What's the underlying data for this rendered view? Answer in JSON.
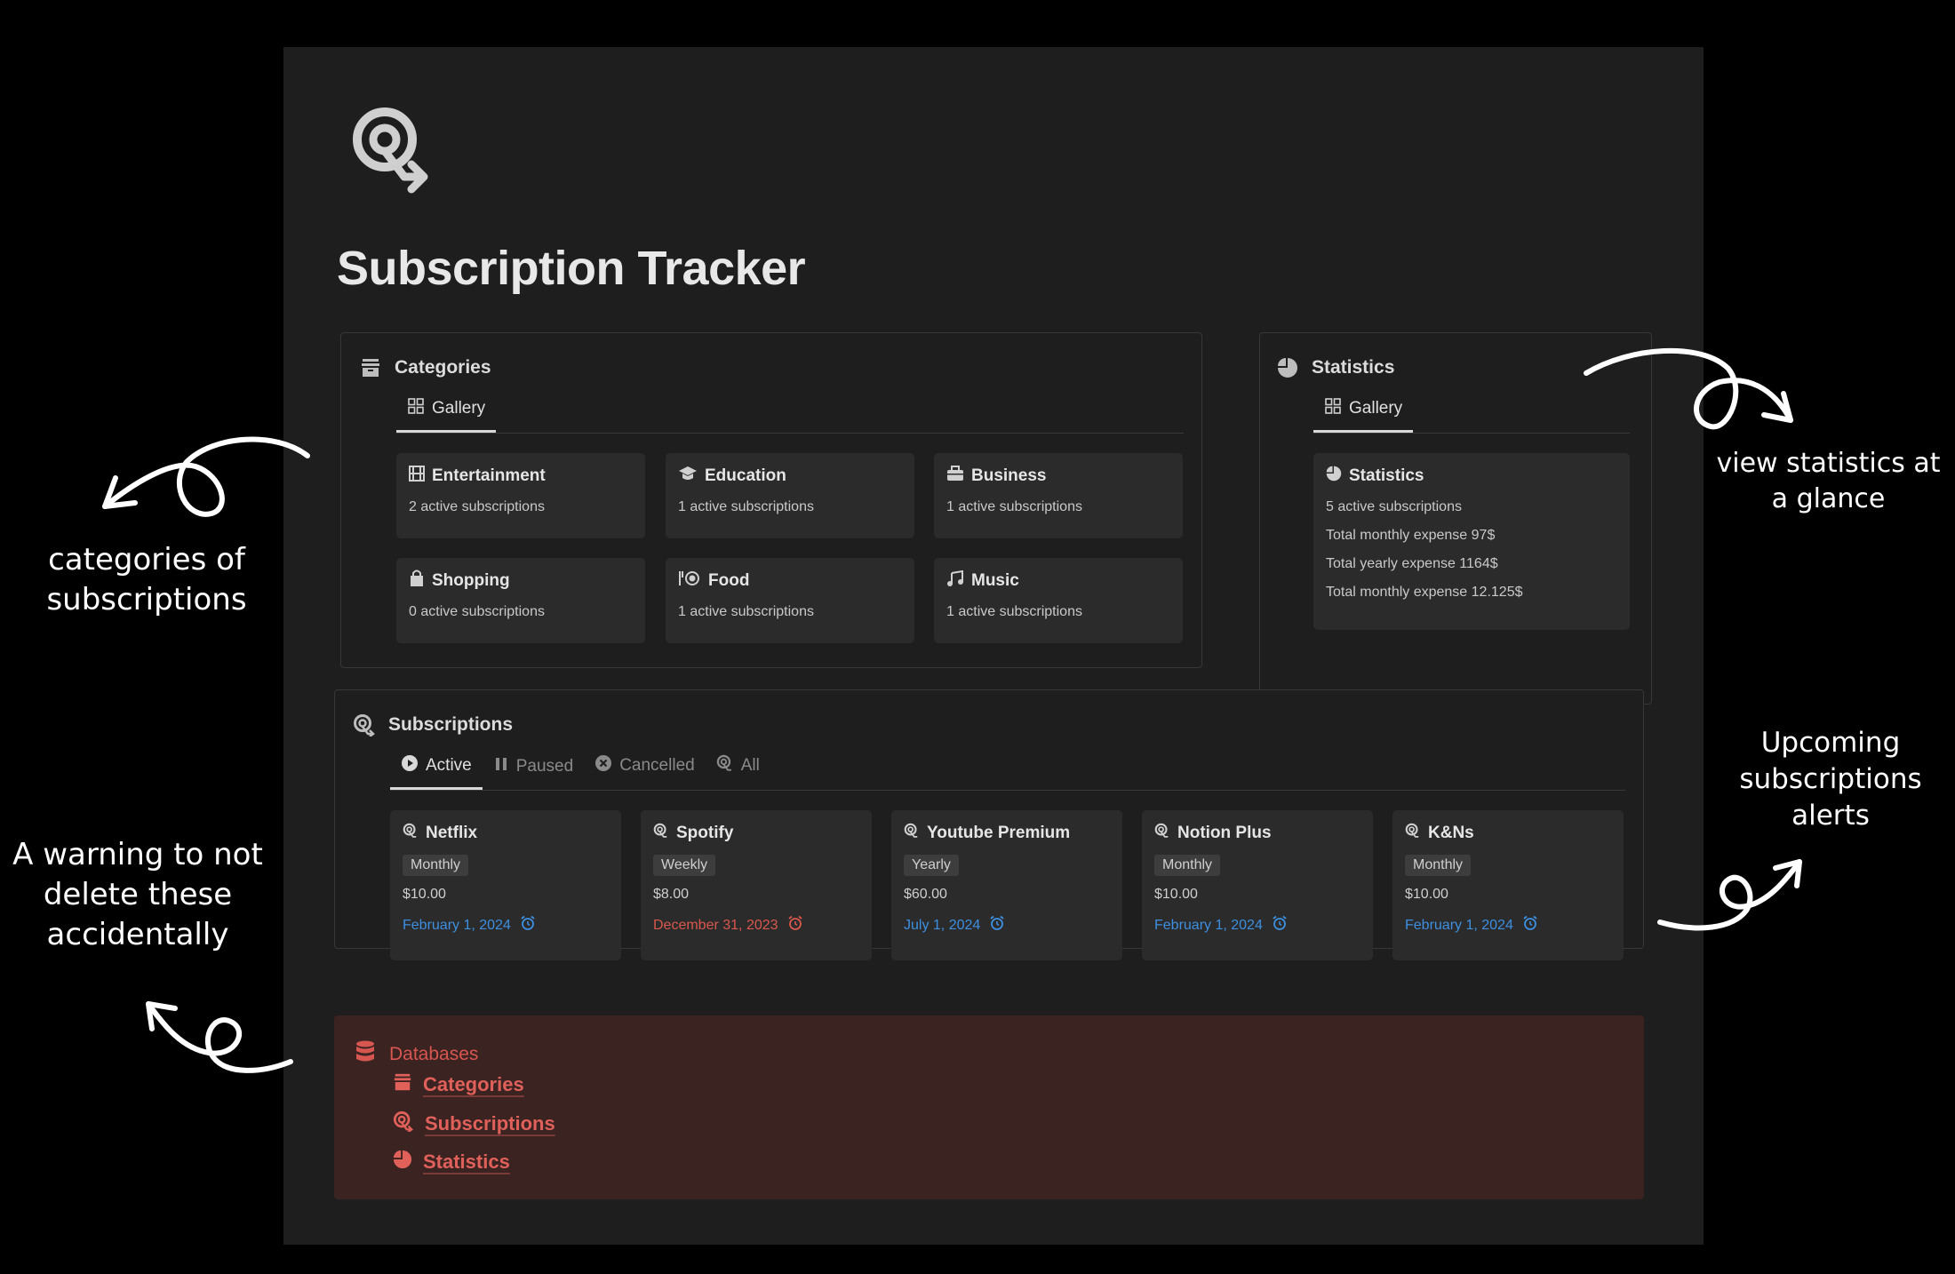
{
  "page": {
    "title": "Subscription Tracker"
  },
  "categories": {
    "title": "Categories",
    "view": "Gallery",
    "items": [
      {
        "icon": "film-icon",
        "name": "Entertainment",
        "count": "2 active subscriptions"
      },
      {
        "icon": "graduation-cap-icon",
        "name": "Education",
        "count": "1 active subscriptions"
      },
      {
        "icon": "briefcase-icon",
        "name": "Business",
        "count": "1 active subscriptions"
      },
      {
        "icon": "shopping-bag-icon",
        "name": "Shopping",
        "count": "0 active subscriptions"
      },
      {
        "icon": "food-icon",
        "name": "Food",
        "count": "1 active subscriptions"
      },
      {
        "icon": "music-icon",
        "name": "Music",
        "count": "1 active subscriptions"
      }
    ]
  },
  "statistics": {
    "title": "Statistics",
    "view": "Gallery",
    "card": {
      "title": "Statistics",
      "lines": [
        "5 active subscriptions",
        "Total monthly expense 97$",
        "Total yearly expense 1164$",
        "Total monthly expense 12.125$"
      ]
    }
  },
  "subscriptions": {
    "title": "Subscriptions",
    "tabs": [
      "Active",
      "Paused",
      "Cancelled",
      "All"
    ],
    "items": [
      {
        "name": "Netflix",
        "cycle": "Monthly",
        "price": "$10.00",
        "due": "February 1, 2024",
        "due_status": "upcoming",
        "due_color": "#3d8fe0"
      },
      {
        "name": "Spotify",
        "cycle": "Weekly",
        "price": "$8.00",
        "due": "December 31, 2023",
        "due_status": "overdue",
        "due_color": "#d9574d"
      },
      {
        "name": "Youtube Premium",
        "cycle": "Yearly",
        "price": "$60.00",
        "due": "July 1, 2024",
        "due_status": "upcoming",
        "due_color": "#3d8fe0"
      },
      {
        "name": "Notion Plus",
        "cycle": "Monthly",
        "price": "$10.00",
        "due": "February 1, 2024",
        "due_status": "upcoming",
        "due_color": "#3d8fe0"
      },
      {
        "name": "K&Ns",
        "cycle": "Monthly",
        "price": "$10.00",
        "due": "February 1, 2024",
        "due_status": "upcoming",
        "due_color": "#3d8fe0"
      }
    ]
  },
  "databases": {
    "title": "Databases",
    "links": [
      "Categories",
      "Subscriptions",
      "Statistics"
    ],
    "accent": "#e0605a",
    "background": "#3b2322"
  },
  "annotations": {
    "categories": "categories of subscriptions",
    "statistics": "view statistics at a glance",
    "alerts": "Upcoming subscriptions alerts",
    "warning": "A warning to not delete these accidentally"
  },
  "colors": {
    "background": "#000000",
    "page": "#1e1e1e",
    "card": "#2b2b2b",
    "link_blue": "#3d8fe0",
    "overdue_red": "#d9574d"
  }
}
